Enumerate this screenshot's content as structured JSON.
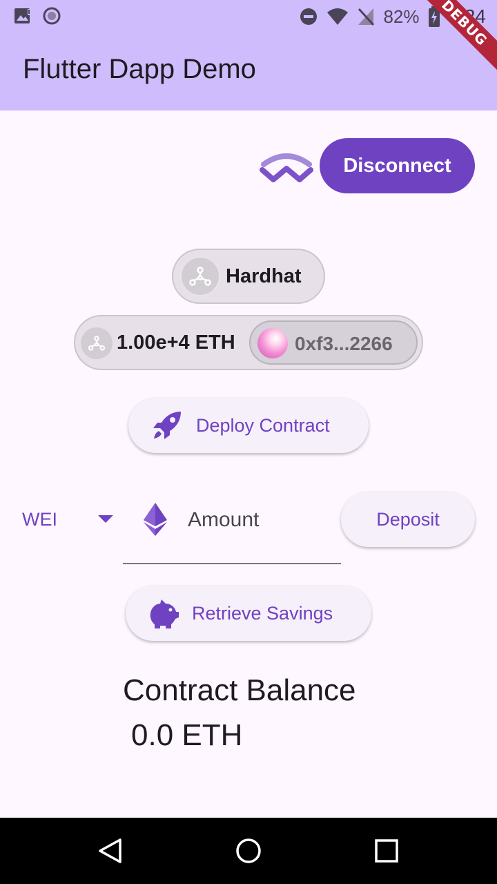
{
  "status_bar": {
    "battery": "82%",
    "time": "8:24"
  },
  "app": {
    "title": "Flutter Dapp Demo",
    "debug_banner": "DEBUG"
  },
  "wallet": {
    "logo": "walletconnect-icon",
    "disconnect_label": "Disconnect"
  },
  "network": {
    "name": "Hardhat",
    "icon": "hardhat-network-icon"
  },
  "account": {
    "balance": "1.00e+4 ETH",
    "address": "0xf3...2266"
  },
  "actions": {
    "deploy_label": "Deploy Contract",
    "deposit_label": "Deposit",
    "retrieve_label": "Retrieve Savings"
  },
  "amount": {
    "unit": "WEI",
    "placeholder": "Amount"
  },
  "balance": {
    "title": "Contract Balance",
    "value": "0.0 ETH"
  },
  "colors": {
    "primary": "#6f42c1",
    "appbar": "#cfbcfd",
    "background": "#fef7ff"
  }
}
